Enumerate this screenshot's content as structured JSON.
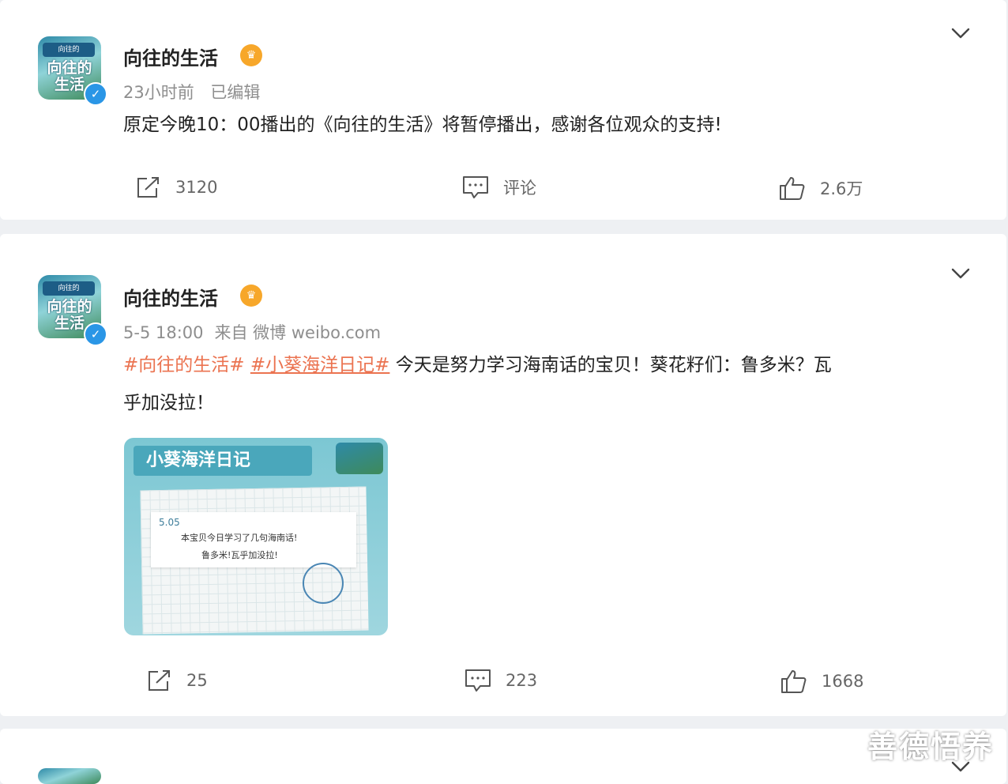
{
  "posts": [
    {
      "author": "向往的生活",
      "avatar_text": "向往的\n生活",
      "avatar_band": "向往的",
      "time": "23小时前",
      "edited": "已编辑",
      "content": "原定今晚10：00播出的《向往的生活》将暂停播出，感谢各位观众的支持!",
      "repost": "3120",
      "comment": "评论",
      "like": "2.6万"
    },
    {
      "author": "向往的生活",
      "avatar_text": "向往的\n生活",
      "avatar_band": "向往的",
      "time": "5-5 18:00",
      "source": "来自 微博 weibo.com",
      "tag1": "#向往的生活#",
      "tag2": "#小葵海洋日记#",
      "content_rest": " 今天是努力学习海南话的宝贝！葵花籽们：鲁多米？瓦",
      "content_line2": "乎加没拉！",
      "image": {
        "title": "小葵海洋日记",
        "date": "5.05",
        "line1": "本宝贝今日学习了几句海南话!",
        "line2": "鲁多米!瓦乎加没拉!"
      },
      "repost": "25",
      "comment": "223",
      "like": "1668"
    }
  ],
  "watermark": "善德悟养",
  "colors": {
    "tag": "#eb7350",
    "verified": "#2a96e6",
    "crown": "#f7a72a"
  },
  "icons": [
    "chevron-down-icon",
    "verified-icon",
    "vip-crown-icon",
    "repost-icon",
    "comment-icon",
    "like-icon"
  ]
}
